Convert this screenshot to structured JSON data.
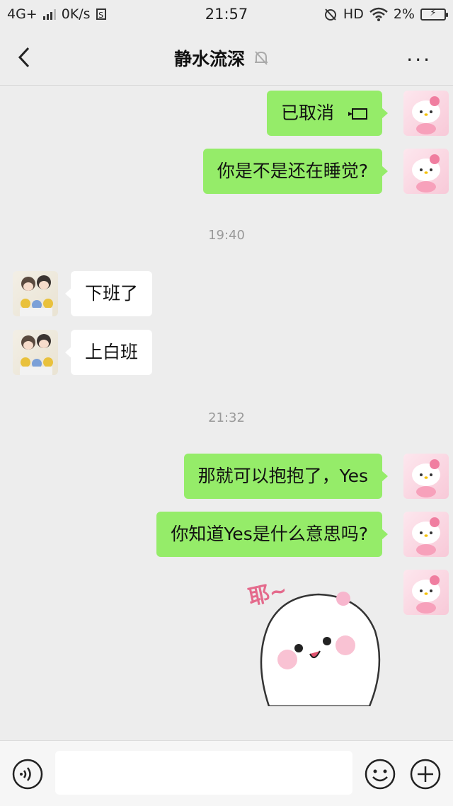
{
  "status_bar": {
    "network": "4G+",
    "speed": "0K/s",
    "sbox": "S",
    "time": "21:57",
    "hd": "HD",
    "battery": "2%"
  },
  "header": {
    "title": "静水流深",
    "more_label": "···"
  },
  "messages": [
    {
      "side": "self",
      "text": "已取消"
    },
    {
      "side": "self",
      "text": "你是不是还在睡觉?"
    },
    {
      "timestamp": "19:40"
    },
    {
      "side": "other",
      "text": "下班了"
    },
    {
      "side": "other",
      "text": "上白班"
    },
    {
      "timestamp": "21:32"
    },
    {
      "side": "self",
      "text": "那就可以抱抱了，Yes"
    },
    {
      "side": "self",
      "text": "你知道Yes是什么意思吗?"
    },
    {
      "side": "self",
      "sticker": "耶~"
    }
  ],
  "colors": {
    "self_bubble": "#95ec69",
    "other_bubble": "#ffffff",
    "background": "#ededed"
  },
  "icons": {
    "back": "chevron-left-icon",
    "mute": "bell-off-icon",
    "voice": "voice-icon",
    "emoji": "emoji-icon",
    "plus": "plus-icon"
  }
}
